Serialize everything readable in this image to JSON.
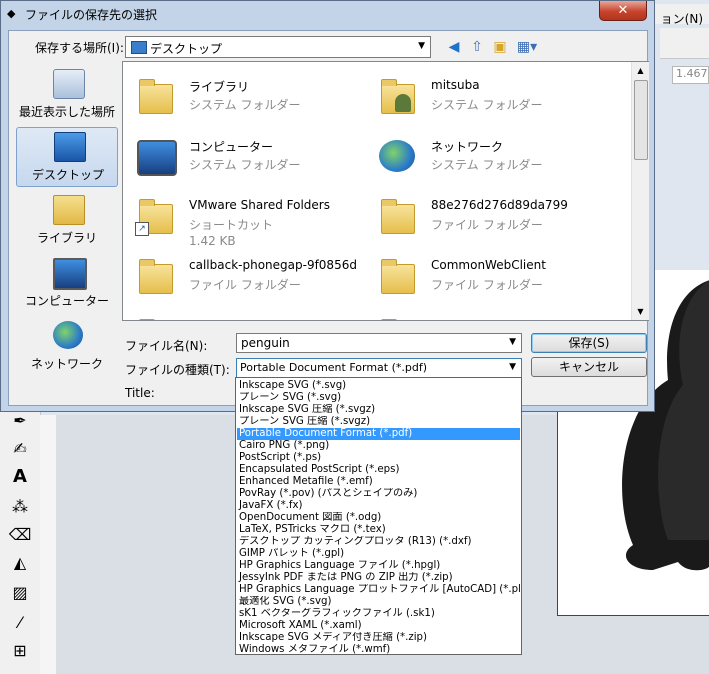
{
  "window": {
    "title": "ファイルの保存先の選択",
    "close_label": "✕"
  },
  "background": {
    "menu_right": "ョン(N)",
    "zoom_value": "1.467"
  },
  "location": {
    "label": "保存する場所(I):",
    "value": "デスクトップ"
  },
  "places": [
    {
      "label": "最近表示した場所",
      "icon": "recent-places-icon"
    },
    {
      "label": "デスクトップ",
      "icon": "desktop-icon"
    },
    {
      "label": "ライブラリ",
      "icon": "library-icon"
    },
    {
      "label": "コンピューター",
      "icon": "computer-icon"
    },
    {
      "label": "ネットワーク",
      "icon": "network-icon"
    }
  ],
  "files": [
    {
      "name": "ライブラリ",
      "type": "システム フォルダー",
      "icon": "library-icon"
    },
    {
      "name": "mitsuba",
      "type": "システム フォルダー",
      "icon": "user-folder-icon"
    },
    {
      "name": "コンピューター",
      "type": "システム フォルダー",
      "icon": "computer-icon"
    },
    {
      "name": "ネットワーク",
      "type": "システム フォルダー",
      "icon": "network-icon"
    },
    {
      "name": "VMware Shared Folders",
      "type": "ショートカット",
      "size": "1.42 KB",
      "icon": "shortcut-folder-icon"
    },
    {
      "name": "88e276d276d89da799",
      "type": "ファイル フォルダー",
      "icon": "folder-icon"
    },
    {
      "name": "callback-phonegap-9f0856d",
      "type": "ファイル フォルダー",
      "icon": "folder-icon"
    },
    {
      "name": "CommonWebClient",
      "type": "ファイル フォルダー",
      "icon": "folder-icon"
    }
  ],
  "filename": {
    "label": "ファイル名(N):",
    "value": "penguin"
  },
  "filetype": {
    "label": "ファイルの種類(T):",
    "value": "Portable Document Format (*.pdf)",
    "options": [
      "Inkscape SVG (*.svg)",
      "プレーン SVG (*.svg)",
      "Inkscape SVG 圧縮 (*.svgz)",
      "プレーン SVG 圧縮 (*.svgz)",
      "Portable Document Format (*.pdf)",
      "Cairo PNG (*.png)",
      "PostScript (*.ps)",
      "Encapsulated PostScript (*.eps)",
      "Enhanced Metafile (*.emf)",
      "PovRay (*.pov) (パスとシェイプのみ)",
      "JavaFX (*.fx)",
      "OpenDocument 図面 (*.odg)",
      "LaTeX, PSTricks マクロ (*.tex)",
      "デスクトップ カッティングプロッタ (R13) (*.dxf)",
      "GIMP パレット (*.gpl)",
      "HP Graphics Language ファイル (*.hpgl)",
      "JessyInk PDF または PNG の ZIP 出力 (*.zip)",
      "HP Graphics Language プロットファイル [AutoCAD] (*.plt)",
      "最適化 SVG (*.svg)",
      "sK1 ベクターグラフィックファイル (.sk1)",
      "Microsoft XAML (*.xaml)",
      "Inkscape SVG メディア付き圧縮 (*.zip)",
      "Windows メタファイル (*.wmf)"
    ],
    "selected_index": 4
  },
  "title_field": {
    "label": "Title:"
  },
  "buttons": {
    "save": "保存(S)",
    "cancel": "キャンセル"
  }
}
